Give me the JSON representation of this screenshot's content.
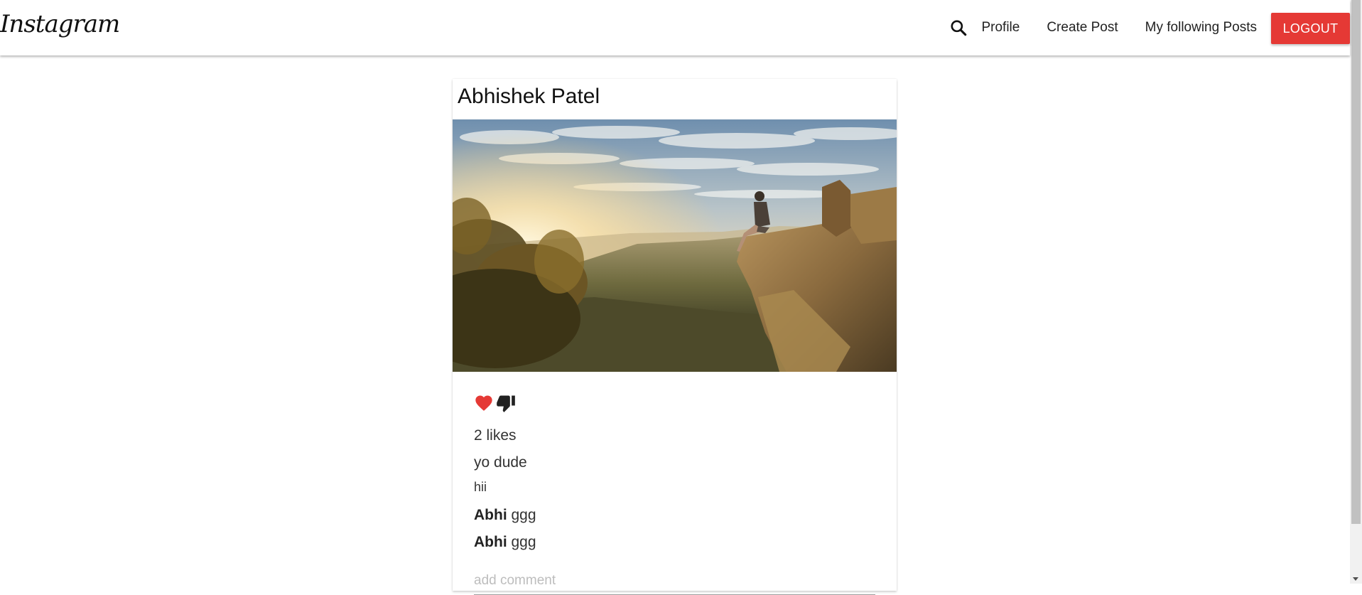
{
  "navbar": {
    "brand": "Instagram",
    "search_icon": "search-icon",
    "links": [
      "Profile",
      "Create Post",
      "My following Posts"
    ],
    "logout_label": "LOGOUT"
  },
  "post": {
    "author": "Abhishek Patel",
    "image_alt": "person sitting on cliff edge at sunrise over forested valley",
    "like_icon": "heart-icon",
    "unlike_icon": "thumbs-down-icon",
    "likes_text": "2 likes",
    "title": "yo dude",
    "body": "hii",
    "comments": [
      {
        "user": "Abhi",
        "text": "ggg"
      },
      {
        "user": "Abhi",
        "text": "ggg"
      }
    ],
    "comment_placeholder": "add comment"
  },
  "colors": {
    "logout_bg": "#e53935",
    "heart": "#e53935",
    "text": "#212121"
  }
}
